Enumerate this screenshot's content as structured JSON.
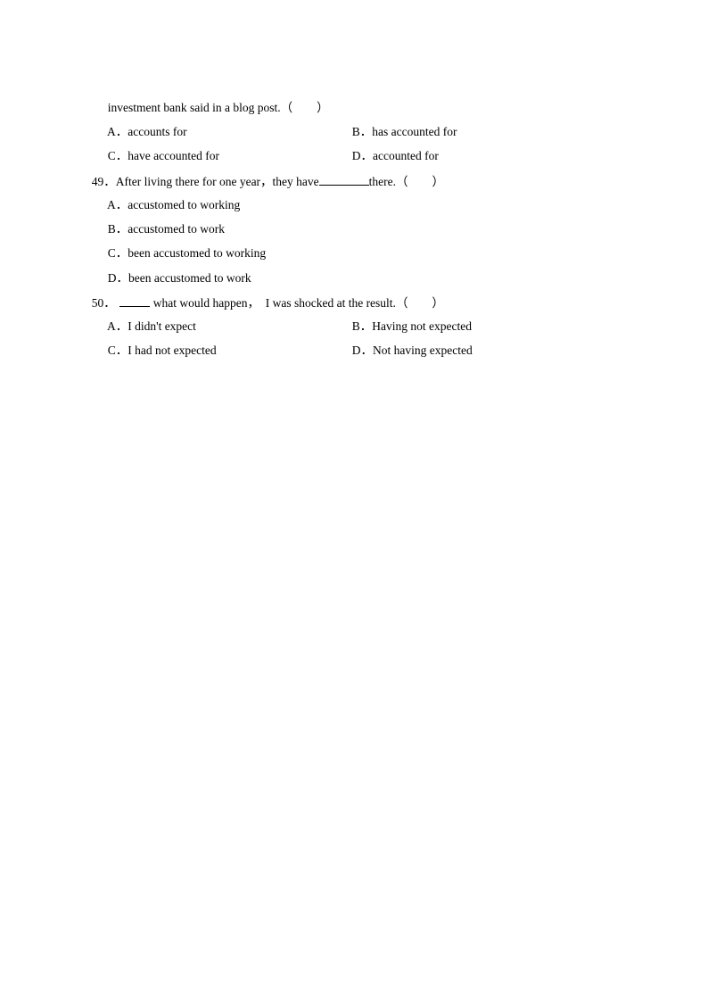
{
  "q48": {
    "stem_tail": "investment bank said in a blog post.",
    "paren": "（　　）",
    "options": [
      {
        "letter": "A．",
        "text": "accounts for"
      },
      {
        "letter": "B．",
        "text": "has accounted for"
      },
      {
        "letter": "C．",
        "text": "have accounted for"
      },
      {
        "letter": "D．",
        "text": "accounted for"
      }
    ]
  },
  "q49": {
    "number": "49．",
    "stem_before": "After living there for one year，they have",
    "stem_after": "there.",
    "paren": "（　　）",
    "options": [
      {
        "letter": "A．",
        "text": "accustomed to working"
      },
      {
        "letter": "B．",
        "text": "accustomed to work"
      },
      {
        "letter": "C．",
        "text": "been accustomed to working"
      },
      {
        "letter": "D．",
        "text": "been accustomed to work"
      }
    ]
  },
  "q50": {
    "number": "50．",
    "stem_after": "what would happen，  I was shocked at the result.",
    "paren": "（　　）",
    "options": [
      {
        "letter": "A．",
        "text": "I didn't expect"
      },
      {
        "letter": "B．",
        "text": "Having not expected"
      },
      {
        "letter": "C．",
        "text": "I had not expected"
      },
      {
        "letter": "D．",
        "text": "Not having expected"
      }
    ]
  }
}
